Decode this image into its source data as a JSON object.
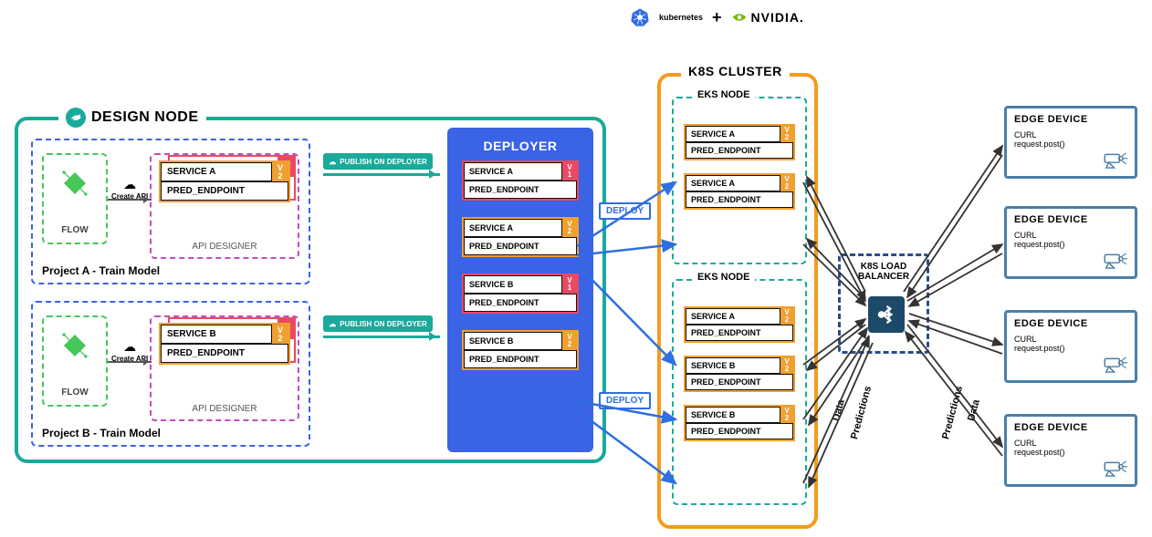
{
  "top": {
    "plus": "+",
    "kubernetes": "kubernetes",
    "nvidia": "NVIDIA."
  },
  "design": {
    "title": "DESIGN NODE",
    "projects": [
      {
        "name": "Project A - Train Model",
        "flow_label": "FLOW",
        "api_label": "API DESIGNER",
        "create_api": "Create API",
        "back": {
          "name": "SERVICE A",
          "ver": "V"
        },
        "front": {
          "name": "SERVICE A",
          "ver_top": "V",
          "ver_bot": "2",
          "endpoint": "PRED_ENDPOINT"
        },
        "publish": "PUBLISH ON DEPLOYER"
      },
      {
        "name": "Project B - Train Model",
        "flow_label": "FLOW",
        "api_label": "API DESIGNER",
        "create_api": "Create API",
        "back": {
          "name": "SERVICE B",
          "ver": "V"
        },
        "front": {
          "name": "SERVICE B",
          "ver_top": "V",
          "ver_bot": "2",
          "endpoint": "PRED_ENDPOINT"
        },
        "publish": "PUBLISH ON DEPLOYER"
      }
    ]
  },
  "deployer": {
    "title": "DEPLOYER",
    "cards": [
      {
        "name": "SERVICE A",
        "ver_top": "V",
        "ver_bot": "1",
        "endpoint": "PRED_ENDPOINT",
        "color": "red"
      },
      {
        "name": "SERVICE A",
        "ver_top": "V",
        "ver_bot": "2",
        "endpoint": "PRED_ENDPOINT",
        "color": "org"
      },
      {
        "name": "SERVICE B",
        "ver_top": "V",
        "ver_bot": "1",
        "endpoint": "PRED_ENDPOINT",
        "color": "red"
      },
      {
        "name": "SERVICE B",
        "ver_top": "V",
        "ver_bot": "2",
        "endpoint": "PRED_ENDPOINT",
        "color": "org"
      }
    ],
    "deploy_label": "DEPLOY"
  },
  "k8s": {
    "title": "K8S CLUSTER",
    "nodes": [
      {
        "title": "EKS NODE",
        "cards": [
          {
            "name": "SERVICE A",
            "ver_top": "V",
            "ver_bot": "2",
            "endpoint": "PRED_ENDPOINT"
          },
          {
            "name": "SERVICE A",
            "ver_top": "V",
            "ver_bot": "2",
            "endpoint": "PRED_ENDPOINT"
          }
        ]
      },
      {
        "title": "EKS NODE",
        "cards": [
          {
            "name": "SERVICE A",
            "ver_top": "V",
            "ver_bot": "2",
            "endpoint": "PRED_ENDPOINT"
          },
          {
            "name": "SERVICE B",
            "ver_top": "V",
            "ver_bot": "2",
            "endpoint": "PRED_ENDPOINT"
          },
          {
            "name": "SERVICE B",
            "ver_top": "V",
            "ver_bot": "2",
            "endpoint": "PRED_ENDPOINT"
          }
        ]
      }
    ]
  },
  "lb": {
    "title1": "K8S LOAD",
    "title2": "BALANCER"
  },
  "labels": {
    "data": "Data",
    "predictions": "Predictions"
  },
  "edges": [
    {
      "title": "EDGE DEVICE",
      "curl": "CURL",
      "req": "request.post()"
    },
    {
      "title": "EDGE DEVICE",
      "curl": "CURL",
      "req": "request.post()"
    },
    {
      "title": "EDGE DEVICE",
      "curl": "CURL",
      "req": "request.post()"
    },
    {
      "title": "EDGE DEVICE",
      "curl": "CURL",
      "req": "request.post()"
    }
  ]
}
